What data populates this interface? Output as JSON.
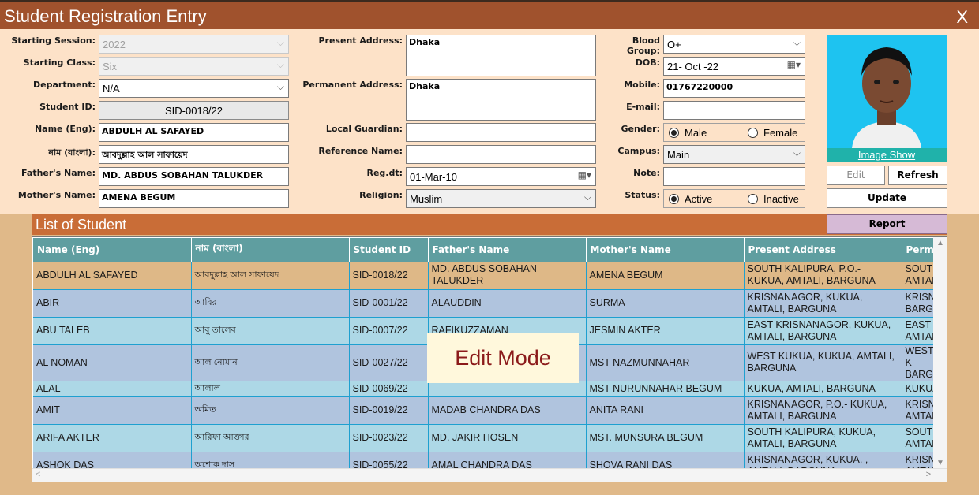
{
  "window": {
    "title": "Student Registration Entry",
    "close": "X"
  },
  "labels": {
    "session": "Starting Session:",
    "class": "Starting Class:",
    "department": "Department:",
    "student_id": "Student ID:",
    "name_eng": "Name (Eng):",
    "name_bn": "নাম (বাংলা):",
    "father": "Father's Name:",
    "mother": "Mother's Name:",
    "present_address": "Present Address:",
    "permanent_address": "Permanent Address:",
    "local_guardian": "Local Guardian:",
    "reference_name": "Reference Name:",
    "reg_dt": "Reg.dt:",
    "religion": "Religion:",
    "blood_group": "Blood Group:",
    "dob": "DOB:",
    "mobile": "Mobile:",
    "email": "E-mail:",
    "gender": "Gender:",
    "campus": "Campus:",
    "note": "Note:",
    "status": "Status:"
  },
  "values": {
    "session": "2022",
    "class": "Six",
    "department": "N/A",
    "student_id": "SID-0018/22",
    "name_eng": "ABDULH AL SAFAYED",
    "name_bn": "আবদুল্লাহ আল সাফায়েদ",
    "father": "MD. ABDUS SOBAHAN TALUKDER",
    "mother": "AMENA BEGUM",
    "present_address": "Dhaka",
    "permanent_address": "Dhaka",
    "local_guardian": "",
    "reference_name": "",
    "reg_dt": "01-Mar-10",
    "religion": "Muslim",
    "blood_group": "O+",
    "dob": "21- Oct -22",
    "mobile": "01767220000",
    "email": "",
    "campus": "Main",
    "note": ""
  },
  "gender": {
    "male": "Male",
    "female": "Female",
    "selected": "male"
  },
  "status": {
    "active": "Active",
    "inactive": "Inactive",
    "selected": "active"
  },
  "buttons": {
    "image_show": "Image Show",
    "edit": "Edit",
    "refresh": "Refresh",
    "update": "Update",
    "report": "Report"
  },
  "list": {
    "title": "List of Student",
    "columns": [
      "Name (Eng)",
      "নাম (বাংলা)",
      "Student ID",
      "Father's Name",
      "Mother's Name",
      "Present Address",
      "Perm"
    ],
    "rows": [
      [
        "ABDULH AL SAFAYED",
        "আবদুল্লাহ আল সাফায়েদ",
        "SID-0018/22",
        "MD. ABDUS SOBAHAN TALUKDER",
        "AMENA BEGUM",
        "SOUTH KALIPURA, P.O.- KUKUA, AMTALI, BARGUNA",
        "SOUTH AMTALI"
      ],
      [
        "ABIR",
        "আবির",
        "SID-0001/22",
        "ALAUDDIN",
        "SURMA",
        "KRISNANAGOR, KUKUA, AMTALI, BARGUNA",
        "KRISNA BARGU"
      ],
      [
        "ABU TALEB",
        "আবু তালেব",
        "SID-0007/22",
        "RAFIKUZZAMAN",
        "JESMIN AKTER",
        "EAST KRISNANAGOR, KUKUA, AMTALI, BARGUNA",
        "EAST K AMTALI"
      ],
      [
        "AL NOMAN",
        "আল নোমান",
        "SID-0027/22",
        "",
        "MST NAZMUNNAHAR",
        "WEST KUKUA, KUKUA, AMTALI, BARGUNA",
        "WEST K BARGU"
      ],
      [
        "ALAL",
        "আলাল",
        "SID-0069/22",
        "",
        "MST NURUNNAHAR BEGUM",
        "KUKUA, AMTALI, BARGUNA",
        "KUKUA"
      ],
      [
        "AMIT",
        "অমিত",
        "SID-0019/22",
        "MADAB CHANDRA DAS",
        "ANITA RANI",
        "KRISNANAGOR, P.O.- KUKUA, AMTALI, BARGUNA",
        "KRISNA AMTALI"
      ],
      [
        "ARIFA AKTER",
        "আরিফা আক্তার",
        "SID-0023/22",
        "MD. JAKIR HOSEN",
        "MST. MUNSURA BEGUM",
        "SOUTH KALIPURA, KUKUA, AMTALI, BARGUNA",
        "SOUTH AMTALI"
      ],
      [
        "ASHOK DAS",
        "অশোক দাস",
        "SID-0055/22",
        "AMAL CHANDRA DAS",
        "SHOVA RANI DAS",
        "KRISNANAGOR, KUKUA, , AMTALI, BARGUNA",
        "KRISNA AMTALI"
      ]
    ]
  },
  "overlay": {
    "edit_mode": "Edit Mode"
  }
}
